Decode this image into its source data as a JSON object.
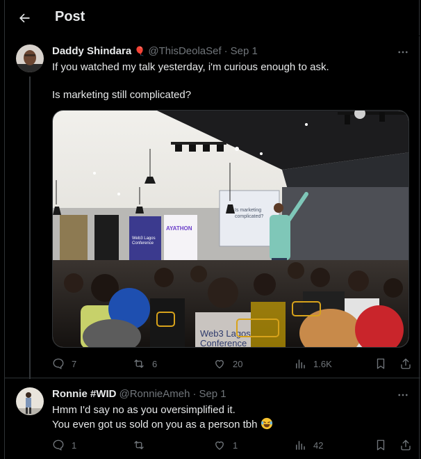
{
  "header": {
    "title": "Post"
  },
  "tweets": [
    {
      "display_name": "Daddy Shindara",
      "badge": "🎈",
      "handle": "@ThisDeolaSef",
      "separator": "·",
      "date": "Sep 1",
      "text": "If you watched my talk yesterday, i'm curious enough to ask.\n\nIs marketing still complicated?",
      "media": {
        "screen_text": "Is marketing\ncomplicated?",
        "banner_brand": "AYATHON",
        "banner_title": "Web3 Lagos\nConference",
        "shirt_text": "Web3 Lagos\nConference"
      },
      "stats": {
        "replies": "7",
        "reposts": "6",
        "likes": "20",
        "views": "1.6K"
      }
    },
    {
      "display_name": "Ronnie #WID",
      "handle": "@RonnieAmeh",
      "separator": "·",
      "date": "Sep 1",
      "text": "Hmm I'd say no as you oversimplified it.\nYou even got us sold on you as a person tbh",
      "emoji": "laughing-tears",
      "stats": {
        "replies": "1",
        "reposts": "",
        "likes": "1",
        "views": "42"
      }
    }
  ],
  "colors": {
    "background": "#000000",
    "text": "#e7e9ea",
    "secondary": "#71767b",
    "border": "#2f3336"
  }
}
